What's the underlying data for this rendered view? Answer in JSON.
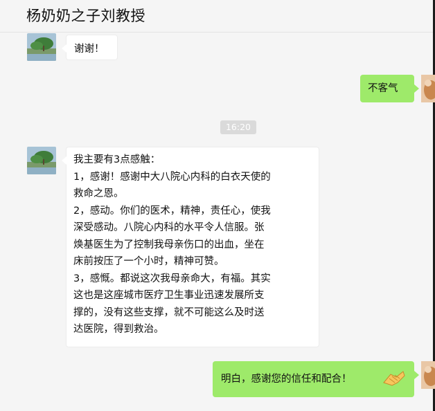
{
  "header": {
    "title": "杨奶奶之子刘教授"
  },
  "messages": [
    {
      "sender": "other",
      "lines": [
        "谢谢！"
      ]
    },
    {
      "sender": "self",
      "lines": [
        "不客气"
      ]
    },
    {
      "type": "time",
      "text": "16:20"
    },
    {
      "sender": "other",
      "lines": [
        "我主要有3点感触：",
        "1，感谢！感谢中大八院心内科的白衣天使的",
        "救命之恩。",
        "2，感动。你们的医术，精神，责任心，使我",
        "深受感动。八院心内科的水平令人信服。张",
        "焕基医生为了控制我母亲伤口的出血，坐在",
        "床前按压了一个小时，精神可赞。",
        "3，感慨。都说这次我母亲命大，有福。其实",
        "这也是这座城市医疗卫生事业迅速发展所支",
        "撑的，没有这些支撑，就不可能这么及时送",
        "达医院，得到救治。"
      ]
    },
    {
      "sender": "self",
      "lines": [
        "明白，感谢您的信任和配合！"
      ],
      "emoji": "handshake-emoji"
    }
  ],
  "colors": {
    "self_bubble": "#9eea6a",
    "other_bubble": "#ffffff",
    "background": "#f5f5f5"
  }
}
